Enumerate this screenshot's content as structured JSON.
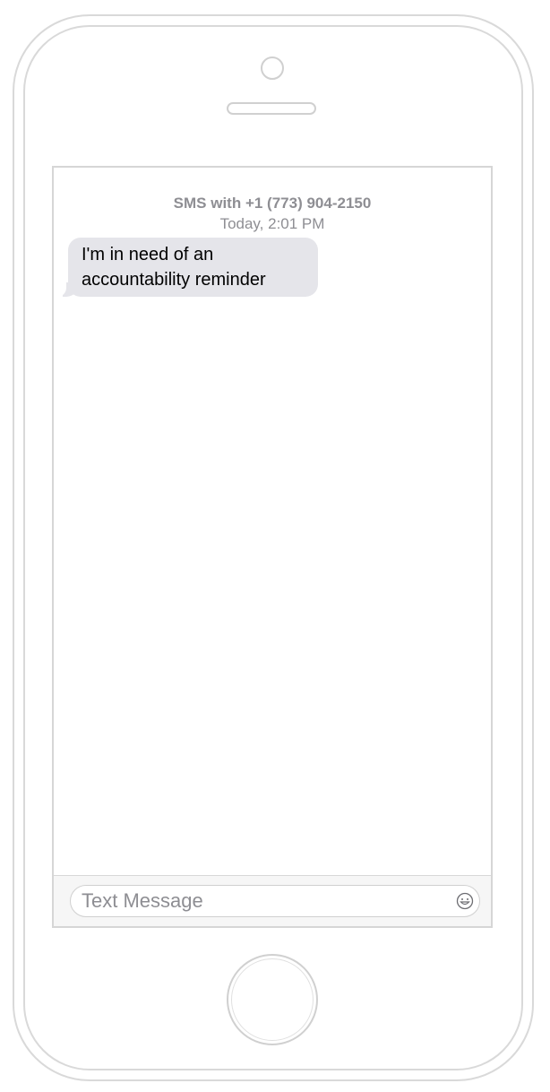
{
  "conversation": {
    "header_line1": "SMS with +1 (773) 904-2150",
    "header_line2": "Today, 2:01 PM",
    "messages": [
      {
        "direction": "incoming",
        "text": "I'm in need of an accountability reminder"
      }
    ]
  },
  "composer": {
    "placeholder": "Text Message",
    "value": "",
    "emoji_icon": "smiley-face-icon"
  },
  "colors": {
    "incoming_bubble": "#e5e5ea",
    "header_text": "#8e8e93",
    "device_outline": "#d9d9d9"
  }
}
